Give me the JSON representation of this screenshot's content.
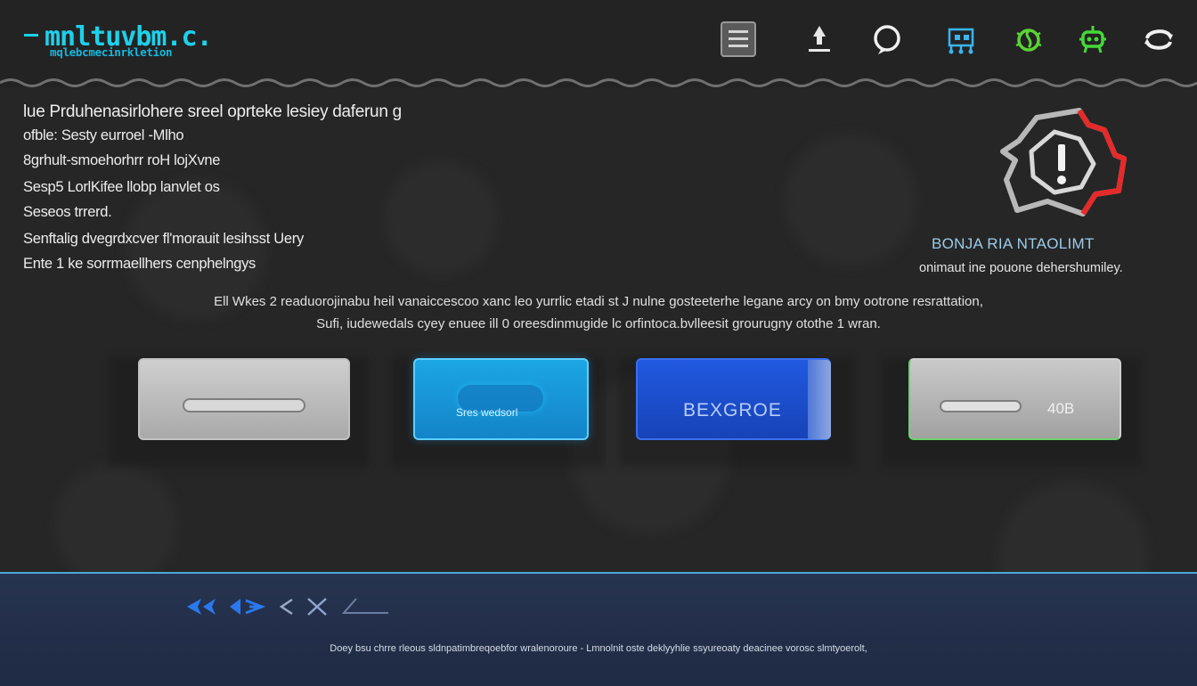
{
  "header": {
    "logo_title": "mnltuvbm.c.",
    "logo_subtitle": "mqlebcmecinrkletion",
    "toolbar_icons": [
      "menu-icon",
      "upload-icon",
      "chat-icon",
      "network-icon",
      "green-bug-icon",
      "green-robot-icon",
      "refresh-icon"
    ]
  },
  "intro": {
    "line1": "lue  Prduhenasirlohere sreel oprteke lesiey daferun g",
    "line2": "ofble: Sesty  eurroel -Mlho",
    "line3": "8grhult-smoehorhrr roH lojXvne",
    "line4": "Sesp5 LorlKifee llobp lanvlet os",
    "line5": "Seseos trrerd.",
    "line6": "Senftalig dvegrdxcver fl'morauit lesihsst  Uery",
    "line7": "Ente 1 ke sorrmaellhers cenphelngys"
  },
  "warning": {
    "icon": "warning-shield-icon",
    "title": "BONJA RIA NTAOLIMT",
    "description": "onimaut ine pouone dehershumiley."
  },
  "description": {
    "line1": "Ell Wkes 2  readuorojinabu heil vanaiccescoo xanc leo yurrlic etadi st J nulne gosteeterhe legane arcy on bmy ootrone resrattation,",
    "line2": "Sufi, iudewedals cyey enuee  ill 0 oreesdinmugide lc orfintoca.bvlleesit grourugny otothe 1 wran."
  },
  "tiles": [
    {
      "label": ""
    },
    {
      "label": "Sres wedsorl"
    },
    {
      "label": "BEXGROE"
    },
    {
      "label": "40B"
    }
  ],
  "footer": {
    "nav_icons": [
      "rewind-icon",
      "back-icon",
      "close-icon",
      "line-icon"
    ],
    "note": "Doey bsu chrre rleous sldnpatimbreqoebfor wralenoroure - Lmnolnit oste deklyyhlie ssyureoaty deacinee vorosc slmtyoerolt,"
  },
  "colors": {
    "accent": "#1ed0ea",
    "panel": "#262626",
    "footer": "#273450",
    "warning": "#e53030"
  }
}
